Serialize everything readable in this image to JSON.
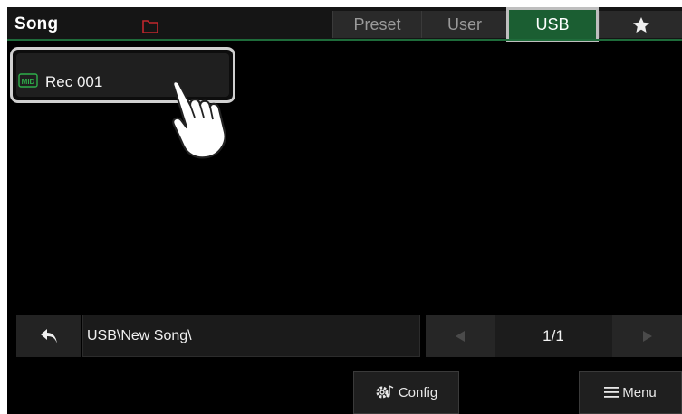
{
  "header": {
    "title": "Song",
    "folder_icon": "folder-icon",
    "tabs": [
      {
        "label": "Preset",
        "active": false
      },
      {
        "label": "User",
        "active": false
      },
      {
        "label": "USB",
        "active": true
      },
      {
        "label": "",
        "icon": "star-icon",
        "active": false
      }
    ]
  },
  "files": [
    {
      "icon": "mid-file-icon",
      "icon_text": "MID",
      "name": "Rec 001",
      "selected": true
    }
  ],
  "pointer": "hand-pointer-icon",
  "path_bar": {
    "back_icon": "back-arrow-icon",
    "path": "USB\\New Song\\"
  },
  "pager": {
    "prev_icon": "triangle-left-icon",
    "page": "1/1",
    "next_icon": "triangle-right-icon"
  },
  "buttons": {
    "config_label": "Config",
    "config_icon": "gear-note-icon",
    "menu_label": "Menu",
    "menu_icon": "hamburger-icon"
  },
  "colors": {
    "accent_green": "#1b5e32",
    "header_line": "#1e6b3a",
    "folder_red": "#c0262d",
    "mid_green": "#2fae4a"
  }
}
